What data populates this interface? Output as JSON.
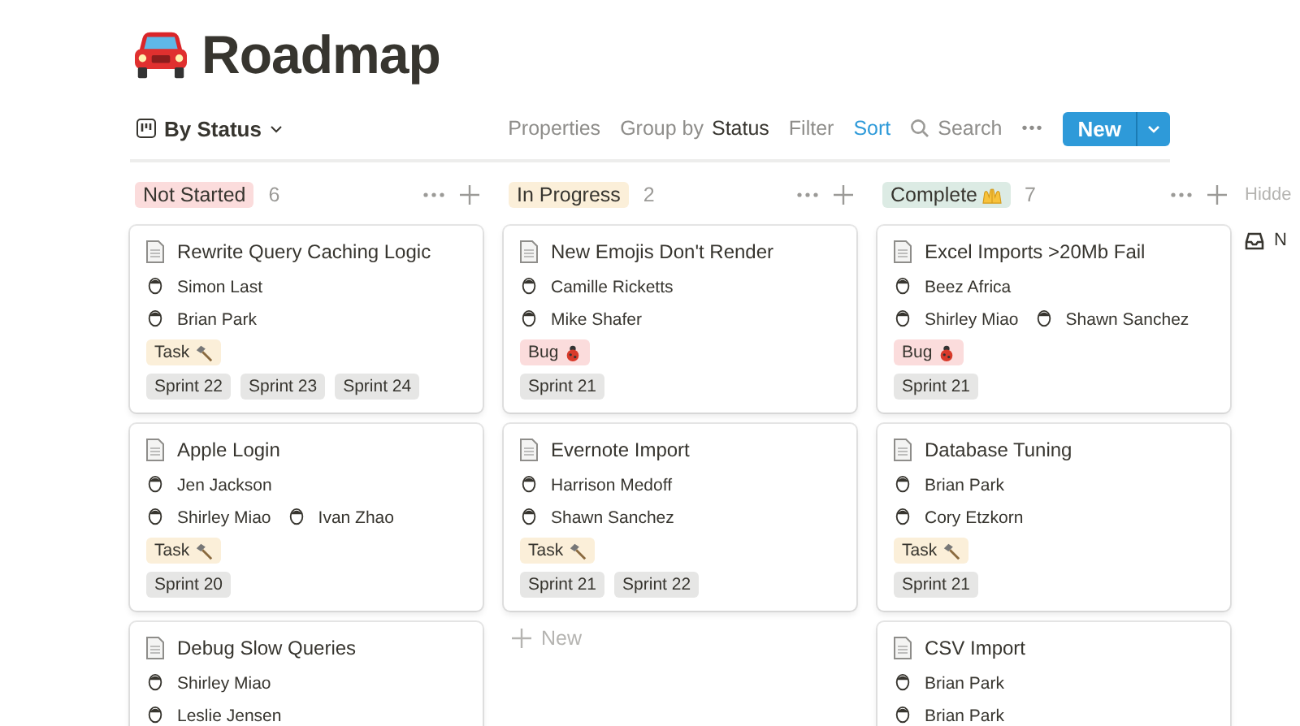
{
  "page": {
    "title": "Roadmap"
  },
  "toolbar": {
    "view": "By Status",
    "items": [
      {
        "kind": "plain",
        "label": "Properties"
      },
      {
        "kind": "group",
        "label": "Group by",
        "value": "Status"
      },
      {
        "kind": "plain",
        "label": "Filter"
      },
      {
        "kind": "active",
        "label": "Sort"
      },
      {
        "kind": "search",
        "label": "Search"
      },
      {
        "kind": "more",
        "label": "•••"
      }
    ],
    "new_button": "New"
  },
  "columns": [
    {
      "label": "Not Started",
      "color": "#fbdcdc",
      "kind": "plain",
      "count": "6",
      "cards": [
        {
          "title": "Rewrite Query Caching Logic",
          "assignee_rows": [
            [
              "Simon Last"
            ],
            [
              "Brian Park"
            ]
          ],
          "tags": [
            {
              "label": "Task",
              "kind": "task",
              "color": "#fbefd9"
            }
          ],
          "sprints": [
            "Sprint 22",
            "Sprint 23",
            "Sprint 24"
          ]
        },
        {
          "title": "Apple Login",
          "assignee_rows": [
            [
              "Jen Jackson"
            ],
            [
              "Shirley Miao",
              "Ivan Zhao"
            ]
          ],
          "tags": [
            {
              "label": "Task",
              "kind": "task",
              "color": "#fbefd9"
            }
          ],
          "sprints": [
            "Sprint 20"
          ]
        },
        {
          "title": "Debug Slow Queries",
          "assignee_rows": [
            [
              "Shirley Miao"
            ],
            [
              "Leslie Jensen"
            ]
          ]
        }
      ]
    },
    {
      "label": "In Progress",
      "color": "#fbefd9",
      "kind": "plain",
      "count": "2",
      "cards": [
        {
          "title": "New Emojis Don't Render",
          "assignee_rows": [
            [
              "Camille Ricketts"
            ],
            [
              "Mike Shafer"
            ]
          ],
          "tags": [
            {
              "label": "Bug",
              "kind": "bug",
              "color": "#fbdcdc"
            }
          ],
          "sprints": [
            "Sprint 21"
          ]
        },
        {
          "title": "Evernote Import",
          "assignee_rows": [
            [
              "Harrison Medoff"
            ],
            [
              "Shawn Sanchez"
            ]
          ],
          "tags": [
            {
              "label": "Task",
              "kind": "task",
              "color": "#fbefd9"
            }
          ],
          "sprints": [
            "Sprint 21",
            "Sprint 22"
          ]
        }
      ],
      "add_new": "New"
    },
    {
      "label": "Complete",
      "color": "#dcebe4",
      "kind": "celebrate",
      "count": "7",
      "cards": [
        {
          "title": "Excel Imports >20Mb Fail",
          "assignee_rows": [
            [
              "Beez Africa"
            ],
            [
              "Shirley Miao",
              "Shawn Sanchez"
            ]
          ],
          "tags": [
            {
              "label": "Bug",
              "kind": "bug",
              "color": "#fbdcdc"
            }
          ],
          "sprints": [
            "Sprint 21"
          ]
        },
        {
          "title": "Database Tuning",
          "assignee_rows": [
            [
              "Brian Park"
            ],
            [
              "Cory Etzkorn"
            ]
          ],
          "tags": [
            {
              "label": "Task",
              "kind": "task",
              "color": "#fbefd9"
            }
          ],
          "sprints": [
            "Sprint 21"
          ]
        },
        {
          "title": "CSV Import",
          "assignee_rows": [
            [
              "Brian Park"
            ],
            [
              "Brian Park"
            ]
          ]
        }
      ]
    }
  ],
  "hidden_column": {
    "label": "Hidde",
    "item": "N"
  }
}
